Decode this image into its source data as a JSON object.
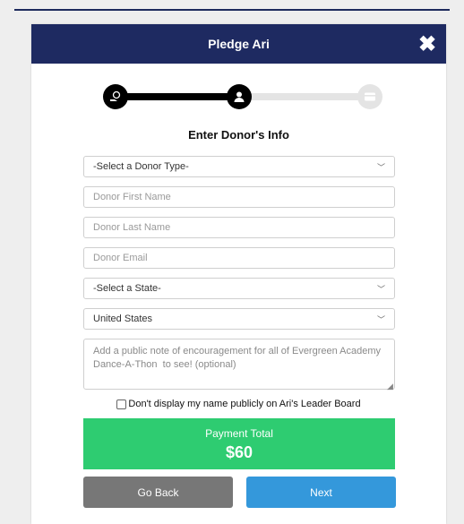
{
  "header": {
    "title": "Pledge Ari",
    "close_symbol": "✖"
  },
  "stepper": {
    "current_step": 2,
    "total_steps": 3
  },
  "form": {
    "section_title": "Enter Donor's Info",
    "donor_type": {
      "selected": "-Select a Donor Type-"
    },
    "first_name": {
      "placeholder": "Donor First Name",
      "value": ""
    },
    "last_name": {
      "placeholder": "Donor Last Name",
      "value": ""
    },
    "email": {
      "placeholder": "Donor Email",
      "value": ""
    },
    "state": {
      "selected": "-Select a State-"
    },
    "country": {
      "selected": "United States"
    },
    "note": {
      "placeholder": "Add a public note of encouragement for all of Evergreen Academy Dance-A-Thon  to see! (optional)",
      "value": ""
    },
    "hide_name": {
      "label": "Don't display my name publicly on Ari's Leader Board",
      "checked": false
    }
  },
  "payment": {
    "label": "Payment Total",
    "amount": "$60"
  },
  "buttons": {
    "back": "Go Back",
    "next": "Next"
  },
  "colors": {
    "header_bg": "#1e2a61",
    "total_bg": "#2ecc71",
    "next_bg": "#3498db",
    "back_bg": "#777777"
  }
}
